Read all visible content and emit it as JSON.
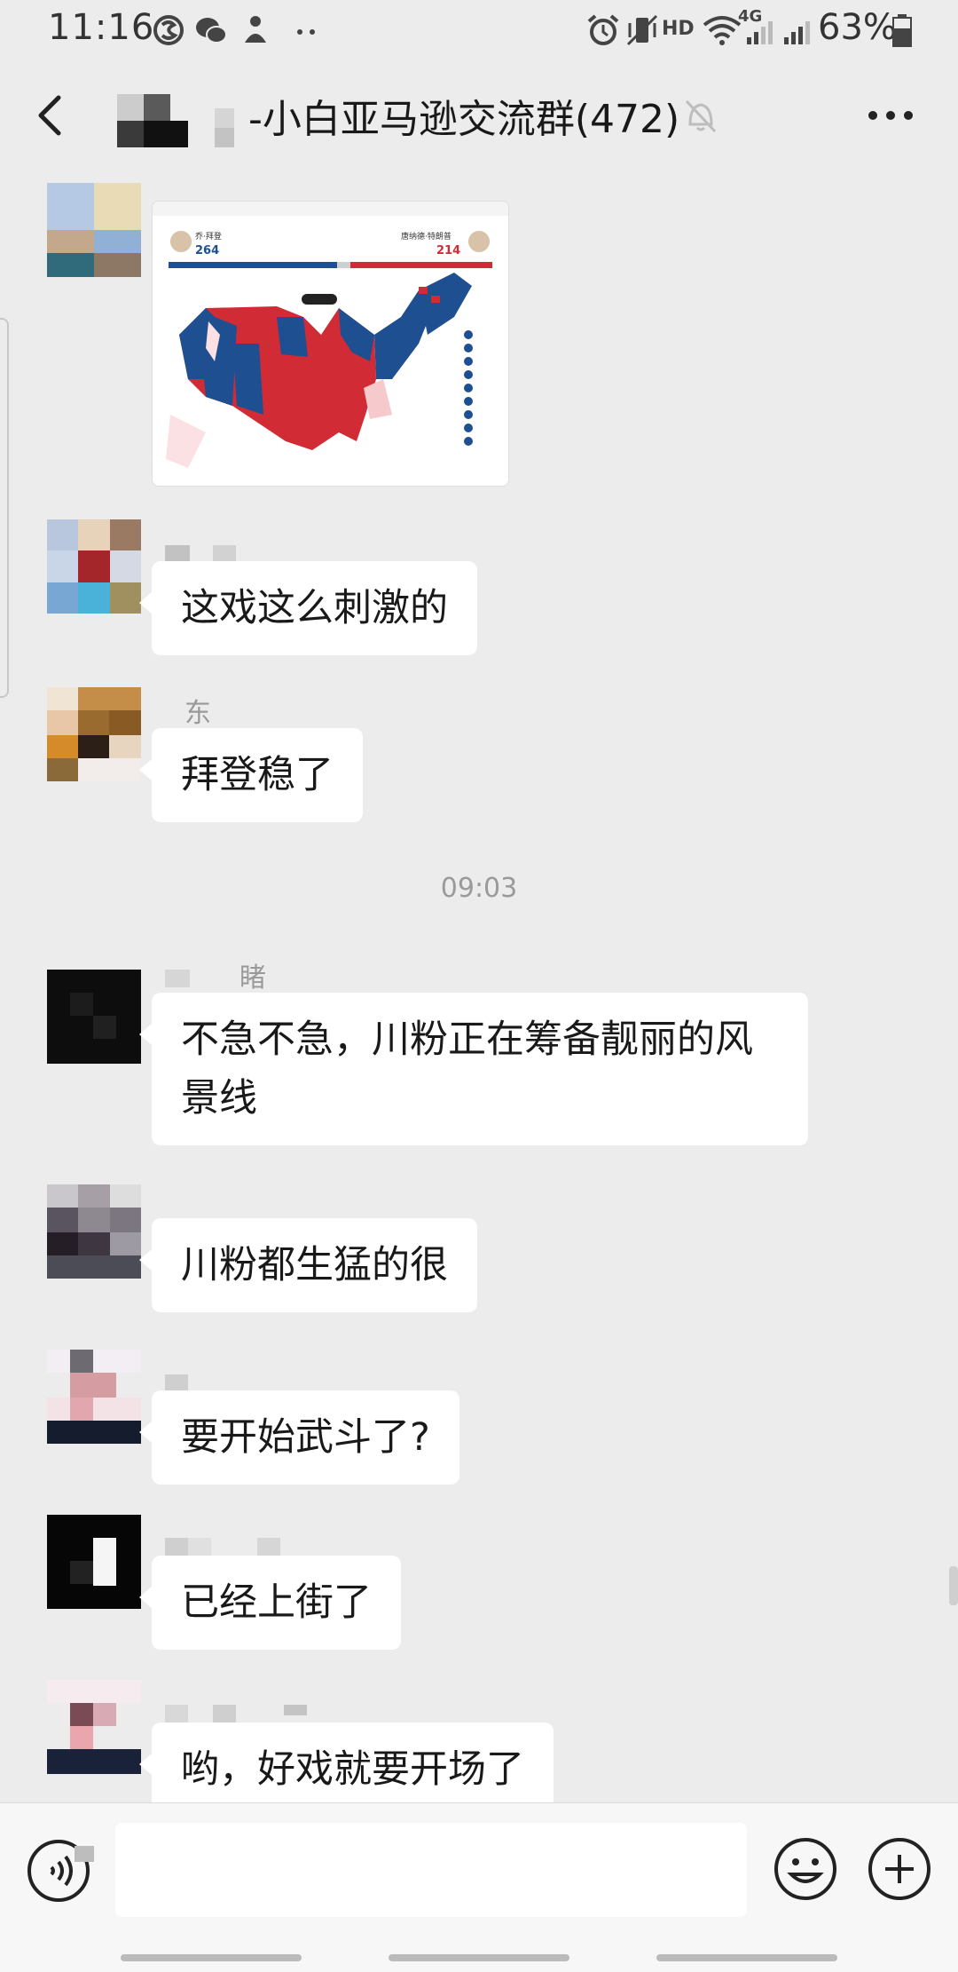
{
  "status_bar": {
    "time": "11:16",
    "network": "4G",
    "hd": "HD",
    "battery_percent": "63%"
  },
  "header": {
    "title": "-小白亚马逊交流群(472)"
  },
  "shared_image": {
    "left_candidate_name": "乔·拜登",
    "left_votes": "264",
    "right_candidate_name": "唐纳德·特朗普",
    "right_votes": "214"
  },
  "messages": [
    {
      "sender": "",
      "text": "这戏这么刺激的"
    },
    {
      "sender": "东",
      "text": "拜登稳了"
    },
    {
      "sender": "",
      "text": "不急不急，川粉正在筹备靓丽的风景线"
    },
    {
      "sender": "",
      "text": "川粉都生猛的很"
    },
    {
      "sender": "",
      "text": "要开始武斗了?"
    },
    {
      "sender": "",
      "text": "已经上街了"
    },
    {
      "sender": "",
      "text": "哟，好戏就要开场了"
    }
  ],
  "time_separator": "09:03",
  "colors": {
    "background": "#ececec",
    "bubble": "#ffffff",
    "blue_state": "#1d4f91",
    "red_state": "#d12b35"
  }
}
